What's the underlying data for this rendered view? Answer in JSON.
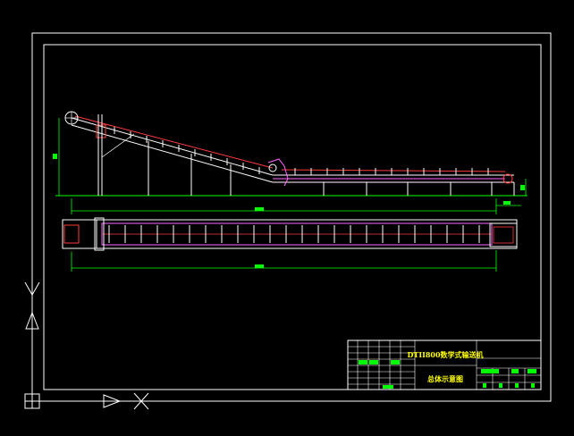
{
  "drawing": {
    "title_line1": "DTII800数学式输送机",
    "title_line2": "总体示意图",
    "colors": {
      "background": "#000000",
      "frame": "#ffffff",
      "conveyor": "#ff3b3b",
      "belt": "#ff66ff",
      "dimension": "#00ff00",
      "text": "#ffff00"
    }
  },
  "viewport": {
    "icons": [
      "ucs-y-axis-icon",
      "ucs-x-axis-icon",
      "ucs-origin-icon"
    ]
  }
}
